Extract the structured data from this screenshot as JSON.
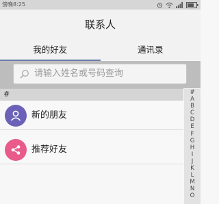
{
  "status_bar": {
    "time": "傍晚8:25",
    "icons": [
      "alarm-icon",
      "wifi-icon",
      "signal-icon",
      "battery-icon"
    ]
  },
  "header": {
    "title": "联系人"
  },
  "tabs": [
    {
      "label": "我的好友",
      "active": true
    },
    {
      "label": "通讯录",
      "active": false
    }
  ],
  "search": {
    "placeholder": "请输入姓名或号码查询"
  },
  "section": {
    "label": "#"
  },
  "list": [
    {
      "label": "新的朋友",
      "avatar_color": "#6b62b8",
      "icon": "person-icon"
    },
    {
      "label": "推荐好友",
      "avatar_color": "#e85b8a",
      "icon": "share-icon"
    }
  ],
  "index_bar": [
    "#",
    "A",
    "B",
    "C",
    "D",
    "E",
    "F",
    "G",
    "H",
    "I",
    "J",
    "K",
    "L",
    "M",
    "N",
    "O"
  ]
}
